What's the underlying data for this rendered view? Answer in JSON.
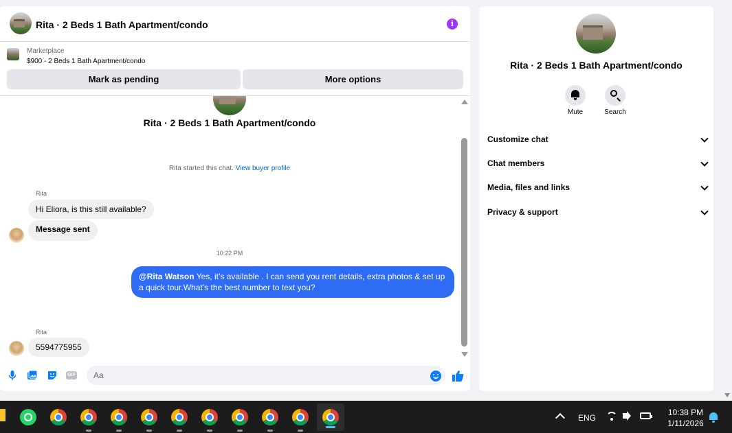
{
  "chat": {
    "title": "Rita · 2 Beds 1 Bath Apartment/condo",
    "info_icon": "i",
    "marketplace": {
      "label": "Marketplace",
      "listing": "$900 - 2 Beds 1 Bath Apartment/condo",
      "mark_pending_label": "Mark as pending",
      "more_options_label": "More options"
    },
    "thread_title": "Rita · 2 Beds 1 Bath Apartment/condo",
    "started_text": "Rita started this chat.",
    "view_buyer_profile": "View buyer profile",
    "messages": [
      {
        "sender": "Rita",
        "text": "Hi Eliora, is this still available?"
      },
      {
        "text": "Message sent"
      },
      {
        "timestamp": "10:22 PM"
      },
      {
        "mention": "@Rita Watson",
        "text": " Yes, it’s available .  I can send you rent details, extra photos & set up a quick tour.What’s the best number to text you?"
      },
      {
        "sender": "Rita",
        "text": "5594775955"
      }
    ],
    "composer": {
      "placeholder": "Aa",
      "gif_label": "GIF"
    }
  },
  "info_panel": {
    "name": "Rita · 2 Beds 1 Bath Apartment/condo",
    "actions": [
      "Mute",
      "Search"
    ],
    "sections": [
      "Customize chat",
      "Chat members",
      "Media, files and links",
      "Privacy & support"
    ]
  },
  "taskbar": {
    "language": "ENG",
    "time": "10:38 PM",
    "date": "1/11/2026",
    "apps": [
      "file-explorer",
      "whatsapp",
      "chrome",
      "chrome",
      "chrome",
      "chrome",
      "chrome",
      "chrome",
      "chrome",
      "chrome",
      "chrome",
      "chrome"
    ]
  },
  "colors": {
    "accent": "#0a7cff",
    "outgoing_bubble": "#2e6cf6",
    "info_icon": "#a033ff",
    "incoming_bubble": "#f0f0f0"
  }
}
